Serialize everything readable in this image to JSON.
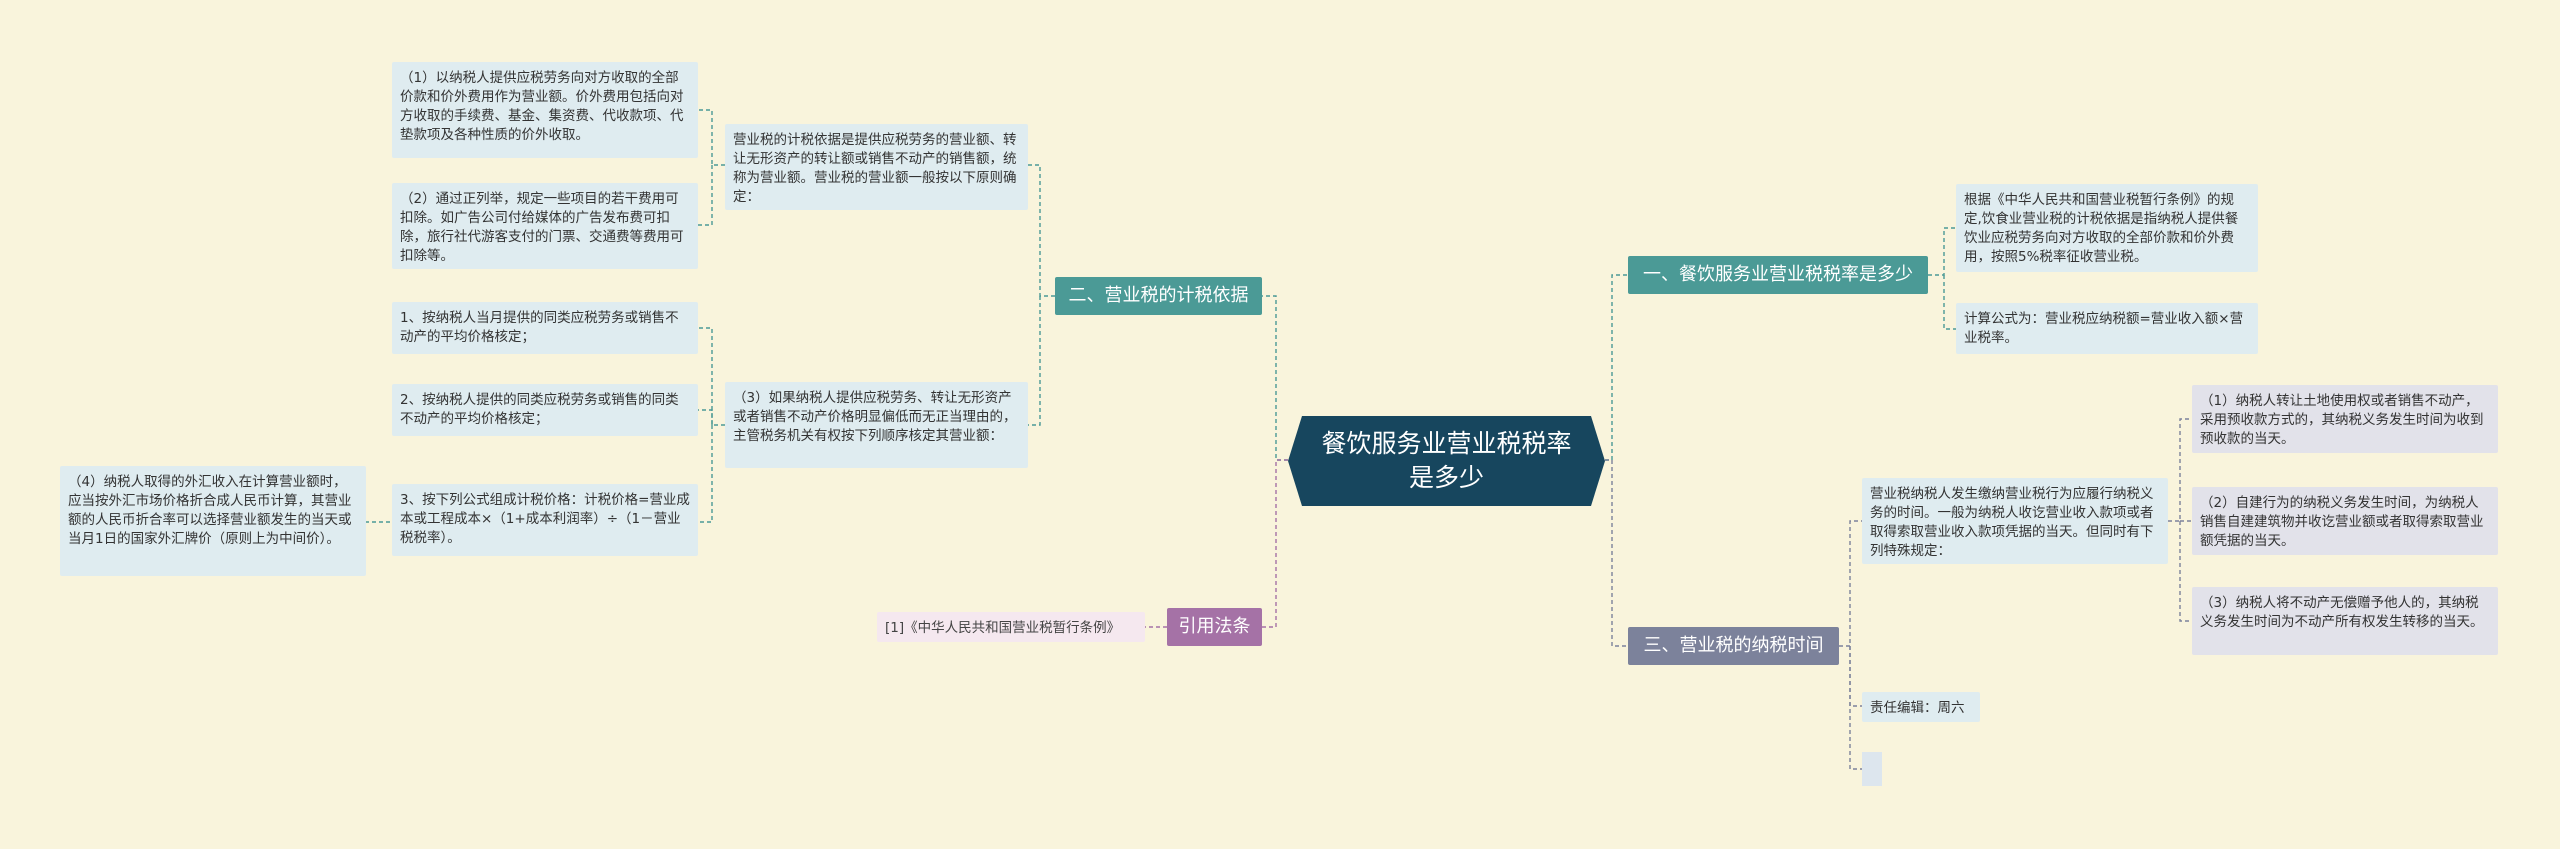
{
  "root": {
    "title": "餐饮服务业营业税税率是多少"
  },
  "branches": {
    "b1": {
      "label": "一、餐饮服务业营业税税率是多少",
      "items": [
        "根据《中华人民共和国营业税暂行条例》的规定,饮食业营业税的计税依据是指纳税人提供餐饮业应税劳务向对方收取的全部价款和价外费用，按照5%税率征收营业税。",
        "计算公式为：营业税应纳税额=营业收入额×营业税率。"
      ]
    },
    "b2": {
      "label": "二、营业税的计税依据",
      "group1": {
        "text": "营业税的计税依据是提供应税劳务的营业额、转让无形资产的转让额或销售不动产的销售额，统称为营业额。营业税的营业额一般按以下原则确定：",
        "items": [
          "（1）以纳税人提供应税劳务向对方收取的全部价款和价外费用作为营业额。价外费用包括向对方收取的手续费、基金、集资费、代收款项、代垫款项及各种性质的价外收取。",
          "（2）通过正列举，规定一些项目的若干费用可扣除。如广告公司付给媒体的广告发布费可扣除，旅行社代游客支付的门票、交通费等费用可扣除等。"
        ]
      },
      "group2": {
        "text": "（3）如果纳税人提供应税劳务、转让无形资产或者销售不动产价格明显偏低而无正当理由的，主管税务机关有权按下列顺序核定其营业额：",
        "items": [
          "1、按纳税人当月提供的同类应税劳务或销售不动产的平均价格核定；",
          "2、按纳税人提供的同类应税劳务或销售的同类不动产的平均价格核定；",
          "3、按下列公式组成计税价格：计税价格=营业成本或工程成本×（1+成本利润率）÷（1－营业税税率）。"
        ],
        "note": "（4）纳税人取得的外汇收入在计算营业额时，应当按外汇市场价格折合成人民币计算，其营业额的人民币折合率可以选择营业额发生的当天或当月1日的国家外汇牌价（原则上为中间价）。"
      }
    },
    "b3": {
      "label": "三、营业税的纳税时间",
      "text": "营业税纳税人发生缴纳营业税行为应履行纳税义务的时间。一般为纳税人收讫营业收入款项或者取得索取营业收入款项凭据的当天。但同时有下列特殊规定：",
      "items": [
        "（1）纳税人转让土地使用权或者销售不动产，采用预收款方式的，其纳税义务发生时间为收到预收款的当天。",
        "（2）自建行为的纳税义务发生时间，为纳税人销售自建建筑物并收讫营业额或者取得索取营业额凭据的当天。",
        "（3）纳税人将不动产无偿赠予他人的，其纳税义务发生时间为不动产所有权发生转移的当天。"
      ],
      "editor": "责任编辑：周六",
      "blank": ""
    },
    "b4": {
      "label": "引用法条",
      "items": [
        "[1]《中华人民共和国营业税暂行条例》"
      ]
    }
  },
  "colors": {
    "background": "#f9f4dc",
    "root": "#17465e",
    "teal": "#4b9a96",
    "slate": "#7c829b",
    "purple": "#a572a6",
    "leaf_blue": "#dfecf0",
    "leaf_grey": "#e2e2ea",
    "leaf_pink": "#f5e8ef"
  }
}
